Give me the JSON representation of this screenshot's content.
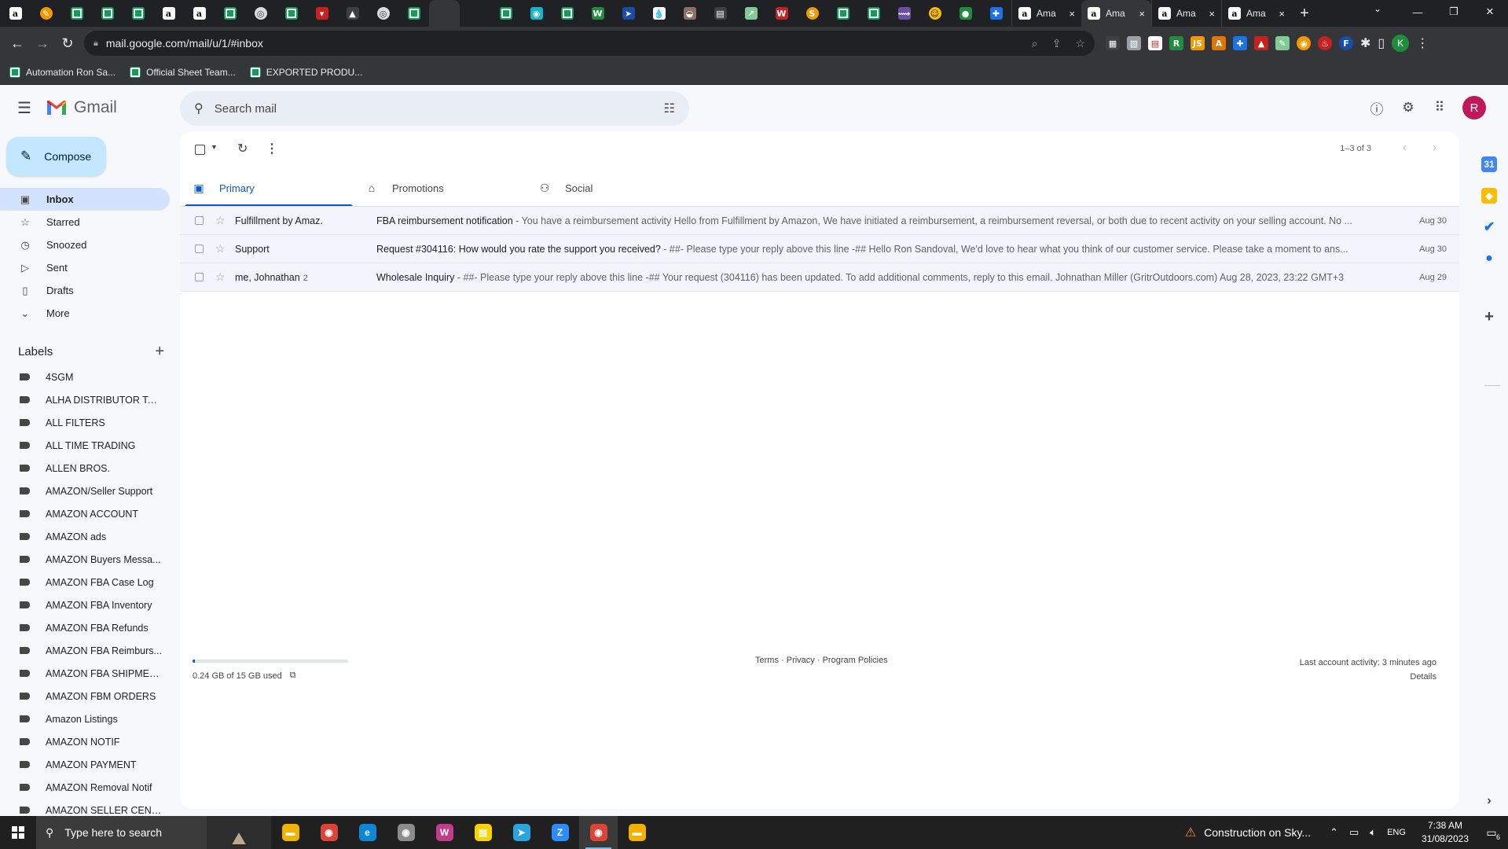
{
  "browser": {
    "pinned_tabs": [
      {
        "icon": "amazon-icon",
        "glyph": "a",
        "style": "amazon"
      },
      {
        "icon": "pencil-app-icon",
        "glyph": "✎",
        "style": "orange"
      },
      {
        "icon": "sheets-icon",
        "glyph": "",
        "style": "sheets"
      },
      {
        "icon": "sheets-icon",
        "glyph": "",
        "style": "sheets"
      },
      {
        "icon": "sheets-icon",
        "glyph": "",
        "style": "sheets"
      },
      {
        "icon": "amazon-icon",
        "glyph": "a",
        "style": "amazon"
      },
      {
        "icon": "amazon-icon",
        "glyph": "a",
        "style": "amazon"
      },
      {
        "icon": "sheets-icon",
        "glyph": "",
        "style": "sheets"
      },
      {
        "icon": "globe-icon",
        "glyph": "◎",
        "style": "round"
      },
      {
        "icon": "sheets-icon",
        "glyph": "",
        "style": "sheets"
      },
      {
        "icon": "red-app-icon",
        "glyph": "▾",
        "style": "red"
      },
      {
        "icon": "arrow-app-icon",
        "glyph": "▲",
        "style": "dark"
      },
      {
        "icon": "globe-icon",
        "glyph": "◎",
        "style": "round"
      },
      {
        "icon": "sheets-icon",
        "glyph": "",
        "style": "sheets"
      },
      {
        "icon": "gmail-icon",
        "glyph": "M",
        "style": "gmail",
        "active": true
      },
      {
        "icon": "gmail-icon",
        "glyph": "M",
        "style": "gmail"
      },
      {
        "icon": "sheets-icon",
        "glyph": "",
        "style": "sheets"
      },
      {
        "icon": "chatgpt-icon",
        "glyph": "◉",
        "style": "teal"
      },
      {
        "icon": "sheets-icon",
        "glyph": "",
        "style": "sheets"
      },
      {
        "icon": "w-app-icon",
        "glyph": "W",
        "style": "green2"
      },
      {
        "icon": "plane-icon",
        "glyph": "➤",
        "style": "navy"
      },
      {
        "icon": "drop-icon",
        "glyph": "💧",
        "style": "white"
      },
      {
        "icon": "hat-icon",
        "glyph": "◒",
        "style": "brown"
      },
      {
        "icon": "news-icon",
        "glyph": "▤",
        "style": "dark"
      },
      {
        "icon": "arrow-icon",
        "glyph": "↗",
        "style": "lime"
      },
      {
        "icon": "w-red-icon",
        "glyph": "W",
        "style": "red"
      },
      {
        "icon": "orange-circle-icon",
        "glyph": "S",
        "style": "orange"
      },
      {
        "icon": "sheets-icon",
        "glyph": "",
        "style": "sheets"
      },
      {
        "icon": "sheets-icon",
        "glyph": "",
        "style": "sheets"
      },
      {
        "icon": "purple-app-icon",
        "glyph": "⟿",
        "style": "purple"
      },
      {
        "icon": "smiley-icon",
        "glyph": "☺",
        "style": "yellow"
      },
      {
        "icon": "green-dot-icon",
        "glyph": "●",
        "style": "green2"
      },
      {
        "icon": "puzzle-blue-icon",
        "glyph": "✚",
        "style": "blue"
      }
    ],
    "full_tabs": [
      {
        "title": "Ama",
        "close": "×",
        "active": false
      },
      {
        "title": "Ama",
        "close": "×",
        "active": true
      },
      {
        "title": "Ama",
        "close": "×",
        "active": false
      },
      {
        "title": "Ama",
        "close": "×",
        "active": false
      }
    ],
    "new_tab": "+",
    "url": "mail.google.com/mail/u/1/#inbox",
    "bookmarks": [
      {
        "label": "Automation Ron Sa..."
      },
      {
        "label": "Official Sheet Team..."
      },
      {
        "label": "EXPORTED PRODU..."
      }
    ],
    "profile_initial": "K"
  },
  "gmail": {
    "app_name": "Gmail",
    "search_placeholder": "Search mail",
    "compose_label": "Compose",
    "account_initial": "R",
    "nav": [
      {
        "label": "Inbox",
        "icon": "inbox-icon",
        "glyph": "▣",
        "active": true
      },
      {
        "label": "Starred",
        "icon": "star-icon",
        "glyph": "☆"
      },
      {
        "label": "Snoozed",
        "icon": "clock-icon",
        "glyph": "◷"
      },
      {
        "label": "Sent",
        "icon": "send-icon",
        "glyph": "▷"
      },
      {
        "label": "Drafts",
        "icon": "draft-icon",
        "glyph": "▯"
      },
      {
        "label": "More",
        "icon": "chevron-down-icon",
        "glyph": "⌄"
      }
    ],
    "labels_title": "Labels",
    "labels": [
      "4SGM",
      "ALHA DISTRIBUTOR Tea...",
      "ALL FILTERS",
      "ALL TIME TRADING",
      "ALLEN BROS.",
      "AMAZON/Seller Support",
      "AMAZON ACCOUNT",
      "AMAZON ads",
      "AMAZON Buyers Messa...",
      "AMAZON FBA Case Log",
      "AMAZON FBA Inventory",
      "AMAZON FBA Refunds",
      "AMAZON FBA Reimburs...",
      "AMAZON FBA SHIPMEN...",
      "AMAZON FBM ORDERS",
      "Amazon Listings",
      "AMAZON NOTIF",
      "AMAZON PAYMENT",
      "AMAZON Removal Notif",
      "AMAZON SELLER CENT..."
    ],
    "pagination": "1–3 of 3",
    "tabs": [
      {
        "label": "Primary",
        "icon": "inbox-icon",
        "glyph": "▣",
        "active": true
      },
      {
        "label": "Promotions",
        "icon": "tag-icon",
        "glyph": "⌂"
      },
      {
        "label": "Social",
        "icon": "people-icon",
        "glyph": "⚇"
      }
    ],
    "emails": [
      {
        "sender": "Fulfillment by Amaz.",
        "count": "",
        "subject": "FBA reimbursement notification",
        "snippet": " - You have a reimbursement activity Hello from Fulfillment by Amazon, We have initiated a reimbursement, a reimbursement reversal, or both due to recent activity on your selling account. No ...",
        "date": "Aug 30"
      },
      {
        "sender": "Support",
        "count": "",
        "subject": "Request #304116: How would you rate the support you received?",
        "snippet": " - ##- Please type your reply above this line -## Hello Ron Sandoval, We'd love to hear what you think of our customer service. Please take a moment to ans...",
        "date": "Aug 30"
      },
      {
        "sender": "me, Johnathan",
        "count": "2",
        "subject": "Wholesale Inquiry",
        "snippet": " - ##- Please type your reply above this line -## Your request (304116) has been updated. To add additional comments, reply to this email. Johnathan Miller (GritrOutdoors.com) Aug 28, 2023, 23:22 GMT+3",
        "date": "Aug 29"
      }
    ],
    "storage_text": "0.24 GB of 15 GB used",
    "storage_fraction": 0.016,
    "footer": {
      "terms": "Terms",
      "sep1": " · ",
      "privacy": "Privacy",
      "sep2": " · ",
      "policies": "Program Policies"
    },
    "activity": {
      "text": "Last account activity: 3 minutes ago",
      "details": "Details"
    }
  },
  "taskbar": {
    "search_placeholder": "Type here to search",
    "weather": "Construction on Sky...",
    "lang": "ENG",
    "time": "7:38 AM",
    "date": "31/08/2023",
    "notifications": "6",
    "apps": [
      {
        "icon": "file-explorer-icon",
        "glyph": "▬",
        "color": "#f0b400"
      },
      {
        "icon": "chrome-icon",
        "glyph": "◉",
        "color": "#db4437"
      },
      {
        "icon": "edge-icon",
        "glyph": "e",
        "color": "#0c88d6"
      },
      {
        "icon": "chrome-beta-icon",
        "glyph": "◉",
        "color": "#8c8c8c"
      },
      {
        "icon": "wps-icon",
        "glyph": "W",
        "color": "#c13d8a"
      },
      {
        "icon": "sticky-notes-icon",
        "glyph": "▤",
        "color": "#f7d400"
      },
      {
        "icon": "telegram-icon",
        "glyph": "➤",
        "color": "#2aa3de"
      },
      {
        "icon": "zoom-icon",
        "glyph": "Z",
        "color": "#2d8cff"
      },
      {
        "icon": "chrome-profile-icon",
        "glyph": "◉",
        "color": "#db4437",
        "active": true
      },
      {
        "icon": "yellow-app-icon",
        "glyph": "▬",
        "color": "#f2b000"
      }
    ]
  }
}
